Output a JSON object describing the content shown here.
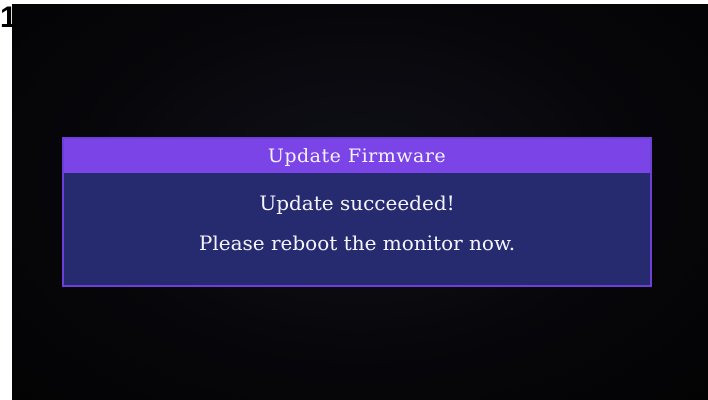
{
  "page": {
    "corner_label": "1"
  },
  "dialog": {
    "title": "Update Firmware",
    "message": "Update succeeded!",
    "instruction": "Please reboot the monitor now."
  },
  "colors": {
    "screen_background": "#050508",
    "dialog_title_bar": "#7a44e6",
    "dialog_body": "#262a6e",
    "dialog_border": "#6b3fd8",
    "text": "#f4f4ff"
  }
}
